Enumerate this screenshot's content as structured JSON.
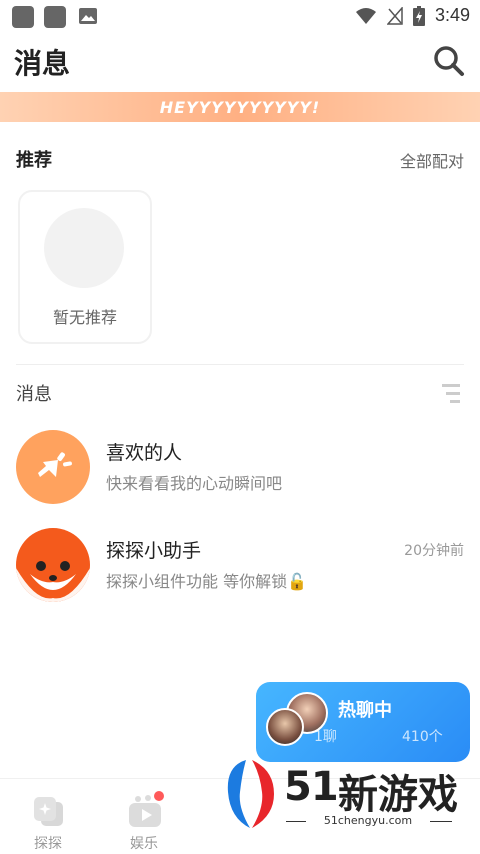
{
  "status_bar": {
    "time": "3:49"
  },
  "header": {
    "title": "消息"
  },
  "banner": {
    "text": "HEYYYYYYYYYY!"
  },
  "recommend": {
    "title": "推荐",
    "link": "全部配对",
    "empty_label": "暂无推荐"
  },
  "messages": {
    "title": "消息",
    "items": [
      {
        "name": "喜欢的人",
        "preview": "快来看看我的心动瞬间吧",
        "time": ""
      },
      {
        "name": "探探小助手",
        "preview": "探探小组件功能 等你解锁🔓",
        "time": "20分钟前"
      }
    ]
  },
  "hot_chat": {
    "title": "热聊中",
    "sub": "1聊",
    "count": "410个"
  },
  "bottom_nav": {
    "items": [
      {
        "label": "探探"
      },
      {
        "label": "娱乐"
      }
    ]
  },
  "watermark": {
    "number": "51",
    "text": "新游戏",
    "url": "51chengyu.com"
  },
  "colors": {
    "accent": "#ff9a5a",
    "hot_chat_bg": "#3aa8ff",
    "badge": "#ff5a5a"
  }
}
